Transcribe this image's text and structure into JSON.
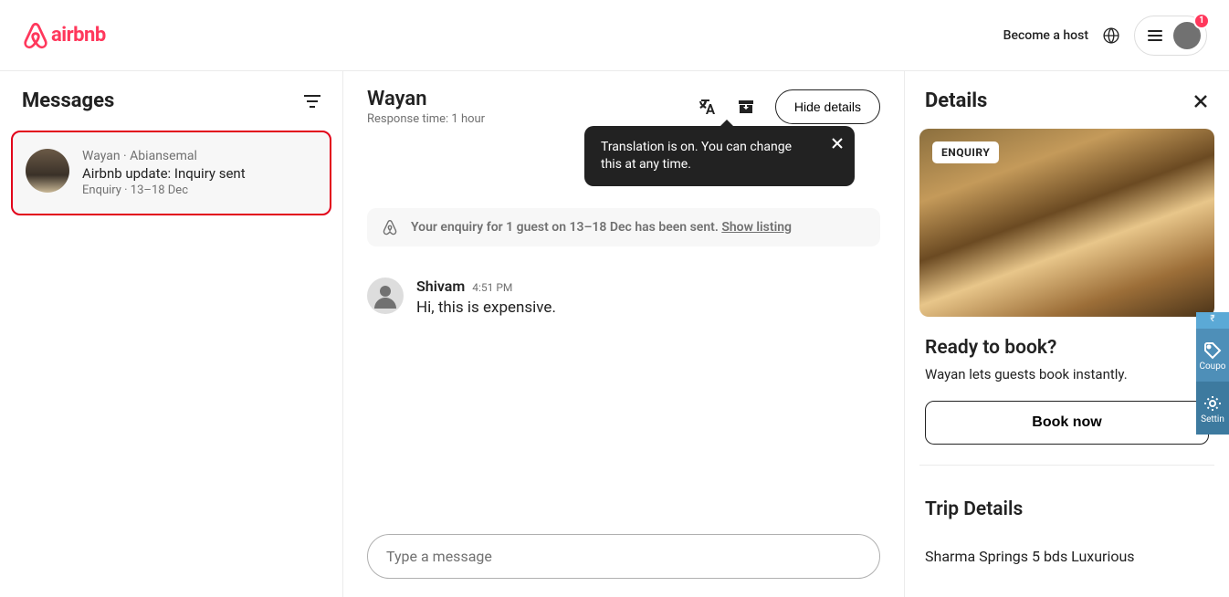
{
  "header": {
    "brand": "airbnb",
    "become_host": "Become a host",
    "notification_count": "1"
  },
  "left": {
    "title": "Messages",
    "thread": {
      "line1": "Wayan · Abiansemal",
      "line2": "Airbnb update: Inquiry sent",
      "line3": "Enquiry · 13–18 Dec"
    }
  },
  "mid": {
    "name": "Wayan",
    "response_label": "Response time: 1 hour",
    "hide_details": "Hide details",
    "tooltip": "Translation is on. You can change this at any time.",
    "banner_prefix": "Your enquiry for 1 guest on 13–18 Dec has been sent. ",
    "show_listing": "Show listing",
    "message": {
      "sender": "Shivam",
      "time": "4:51 PM",
      "text": "Hi, this is expensive."
    },
    "compose_placeholder": "Type a message"
  },
  "right": {
    "title": "Details",
    "badge": "ENQUIRY",
    "ready_title": "Ready to book?",
    "ready_text": "Wayan lets guests book instantly.",
    "book_btn": "Book now",
    "trip_title": "Trip Details",
    "trip_listing": "Sharma Springs 5 bds Luxurious"
  },
  "side": {
    "currency": "₹",
    "coupon": "Coupo",
    "settings": "Settin"
  }
}
